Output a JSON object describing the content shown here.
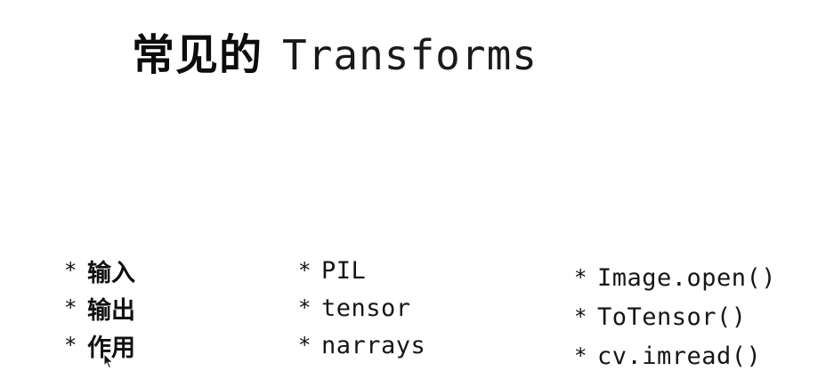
{
  "title": {
    "chinese": "常见的",
    "english": "Transforms"
  },
  "bullet_symbol": "*",
  "columns": [
    {
      "items": [
        "输入",
        "输出",
        "作用"
      ]
    },
    {
      "items": [
        "PIL",
        "tensor",
        "narrays"
      ]
    },
    {
      "items": [
        "Image.open()",
        "ToTensor()",
        "cv.imread()"
      ]
    }
  ]
}
